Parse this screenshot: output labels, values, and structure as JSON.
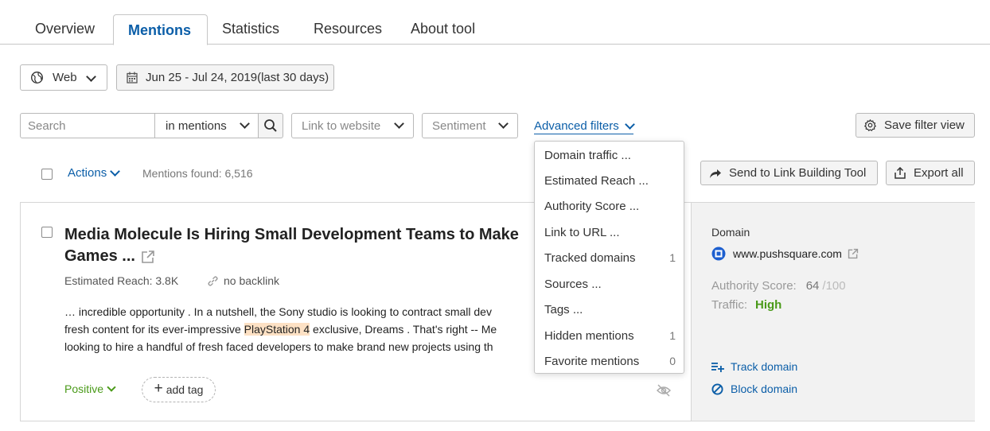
{
  "tabs": [
    {
      "label": "Overview"
    },
    {
      "label": "Mentions"
    },
    {
      "label": "Statistics"
    },
    {
      "label": "Resources"
    },
    {
      "label": "About tool"
    }
  ],
  "filters": {
    "source": "Web",
    "date_range": "Jun 25 - Jul 24, 2019(last 30 days)",
    "search_placeholder": "Search",
    "search_scope": "in mentions",
    "link_to_website": "Link to website",
    "sentiment": "Sentiment",
    "advanced_filters": "Advanced filters",
    "save_filter_view": "Save filter view"
  },
  "toolbar": {
    "actions": "Actions",
    "mentions_found": "Mentions found: 6,516",
    "send_to_link_building": "Send to Link Building Tool",
    "export_all": "Export all"
  },
  "mention": {
    "title_line1": "Media Molecule Is Hiring Small Development Teams to Make",
    "title_line2": "Games ...",
    "estimated_reach": "Estimated Reach: 3.8K",
    "backlink": "no backlink",
    "snippet_line1": "… incredible opportunity . In a nutshell, the Sony studio is looking to contract small dev",
    "snippet_line2_pre": "fresh content for its ever-impressive ",
    "snippet_highlight": "PlayStation 4",
    "snippet_line2_post": " exclusive, Dreams . That's right -- Me",
    "snippet_line3": "looking to hire a handful of fresh faced developers to make brand new projects using th",
    "sentiment": "Positive",
    "add_tag": "add tag"
  },
  "domain_panel": {
    "label": "Domain",
    "domain": "www.pushsquare.com",
    "authority_label": "Authority Score:",
    "authority_value": "64",
    "authority_max": "/100",
    "traffic_label": "Traffic:",
    "traffic_value": "High",
    "track_domain": "Track domain",
    "block_domain": "Block domain"
  },
  "advanced_menu": [
    {
      "label": "Domain traffic ...",
      "count": ""
    },
    {
      "label": "Estimated Reach ...",
      "count": ""
    },
    {
      "label": "Authority Score ...",
      "count": ""
    },
    {
      "label": "Link to URL ...",
      "count": ""
    },
    {
      "label": "Tracked domains",
      "count": "1"
    },
    {
      "label": "Sources ...",
      "count": ""
    },
    {
      "label": "Tags ...",
      "count": ""
    },
    {
      "label": "Hidden mentions",
      "count": "1"
    },
    {
      "label": "Favorite mentions",
      "count": "0"
    }
  ],
  "colors": {
    "accent_blue": "#0b5ea8",
    "positive_green": "#4a9a19",
    "highlight": "#fde1c4"
  }
}
